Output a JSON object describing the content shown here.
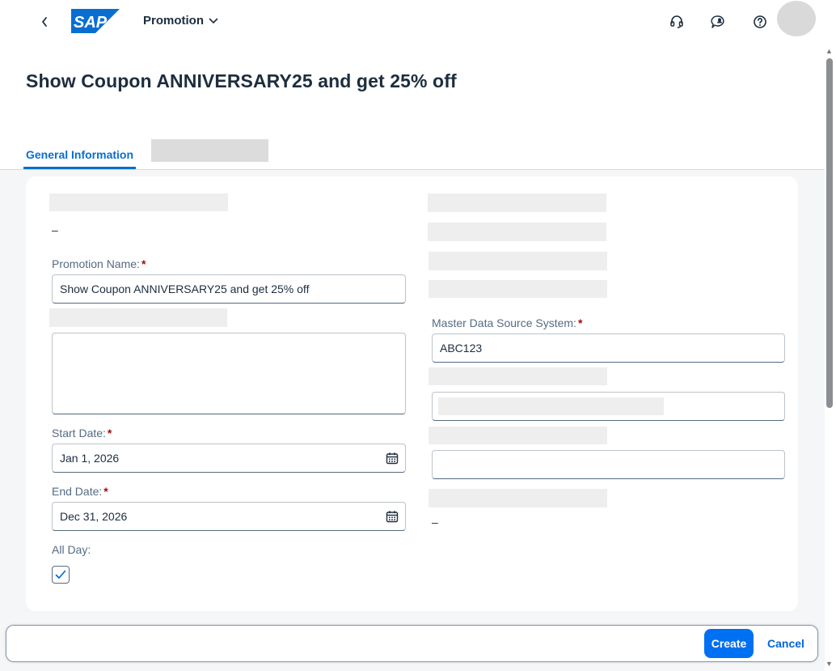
{
  "shell": {
    "app_title": "Promotion",
    "logo_text": "SAP",
    "brand_color": "#0a6ed1",
    "icons": [
      "back-icon",
      "headset-icon",
      "feedback-icon",
      "help-icon",
      "avatar"
    ]
  },
  "header": {
    "title": "Show Coupon ANNIVERSARY25 and get 25% off",
    "tabs": [
      {
        "label": "General Information",
        "selected": true
      }
    ]
  },
  "form": {
    "left": {
      "readonly_value": "–",
      "promotion_name_label": "Promotion Name:",
      "promotion_name_value": "Show Coupon ANNIVERSARY25 and get 25% off",
      "description_value": "",
      "start_date_label": "Start Date:",
      "start_date_value": "Jan 1, 2026",
      "end_date_label": "End Date:",
      "end_date_value": "Dec 31, 2026",
      "all_day_label": "All Day:",
      "all_day_checked": true
    },
    "right": {
      "master_data_label": "Master Data Source System:",
      "master_data_value": "ABC123",
      "field_3_value": "",
      "readonly_value": "–"
    },
    "required_marker": "*"
  },
  "footer": {
    "create_label": "Create",
    "cancel_label": "Cancel"
  }
}
